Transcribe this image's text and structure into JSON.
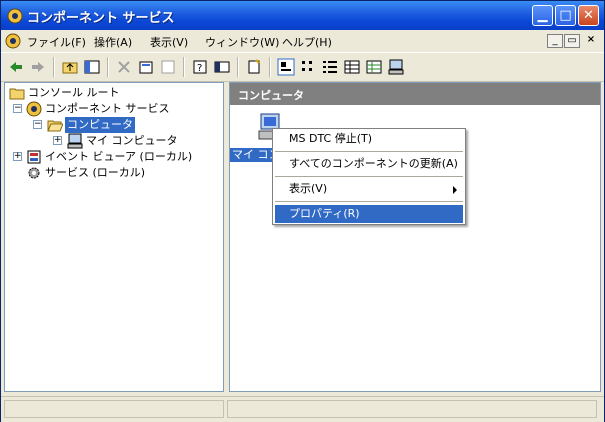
{
  "window": {
    "title": "コンポーネント サービス",
    "title_icon": "component-services-icon",
    "controls": [
      "minimize-icon",
      "maximize-icon",
      "close-icon"
    ]
  },
  "menubar": {
    "items": [
      {
        "label": "ファイル(F)"
      },
      {
        "label": "操作(A)"
      },
      {
        "label": "表示(V)"
      },
      {
        "label": "ウィンドウ(W)"
      },
      {
        "label": "ヘルプ(H)"
      }
    ],
    "mdi_controls": [
      "_",
      "▭",
      "×"
    ]
  },
  "toolbar": {
    "buttons": [
      "back-icon",
      "forward-icon",
      "up-folder-icon",
      "show-hide-tree-icon",
      "delete-icon",
      "properties-icon",
      "refresh-icon",
      "help-icon",
      "console-icon",
      "new-icon",
      "large-icons-icon",
      "small-icons-icon",
      "list-icon",
      "details-icon",
      "status-view-icon",
      "computer-icon"
    ]
  },
  "tree": {
    "items": [
      {
        "label": "コンソール ルート",
        "icon": "folder-icon",
        "level": 0,
        "expander": ""
      },
      {
        "label": "コンポーネント サービス",
        "icon": "component-services-icon",
        "level": 1,
        "expander": "−"
      },
      {
        "label": "コンピュータ",
        "icon": "folder-open-icon",
        "level": 2,
        "expander": "−",
        "selected": true
      },
      {
        "label": "マイ コンピュータ",
        "icon": "computer-icon",
        "level": 3,
        "expander": "+"
      },
      {
        "label": "イベント ビューア (ローカル)",
        "icon": "event-viewer-icon",
        "level": 1,
        "expander": "+"
      },
      {
        "label": "サービス (ローカル)",
        "icon": "services-gear-icon",
        "level": 1,
        "expander": ""
      }
    ]
  },
  "right_pane": {
    "header": "コンピュータ",
    "item_label": "マイ コン"
  },
  "context_menu": {
    "items": [
      {
        "label": "MS DTC 停止(T)"
      },
      {
        "label": "すべてのコンポーネントの更新(A)"
      },
      {
        "label": "表示(V)",
        "submenu": true
      },
      {
        "label": "プロパティ(R)",
        "highlighted": true
      }
    ]
  },
  "colors": {
    "titlebar": "#0b47d6",
    "selection": "#316ac5",
    "pane_header": "#808080",
    "chrome": "#ece9d8"
  }
}
